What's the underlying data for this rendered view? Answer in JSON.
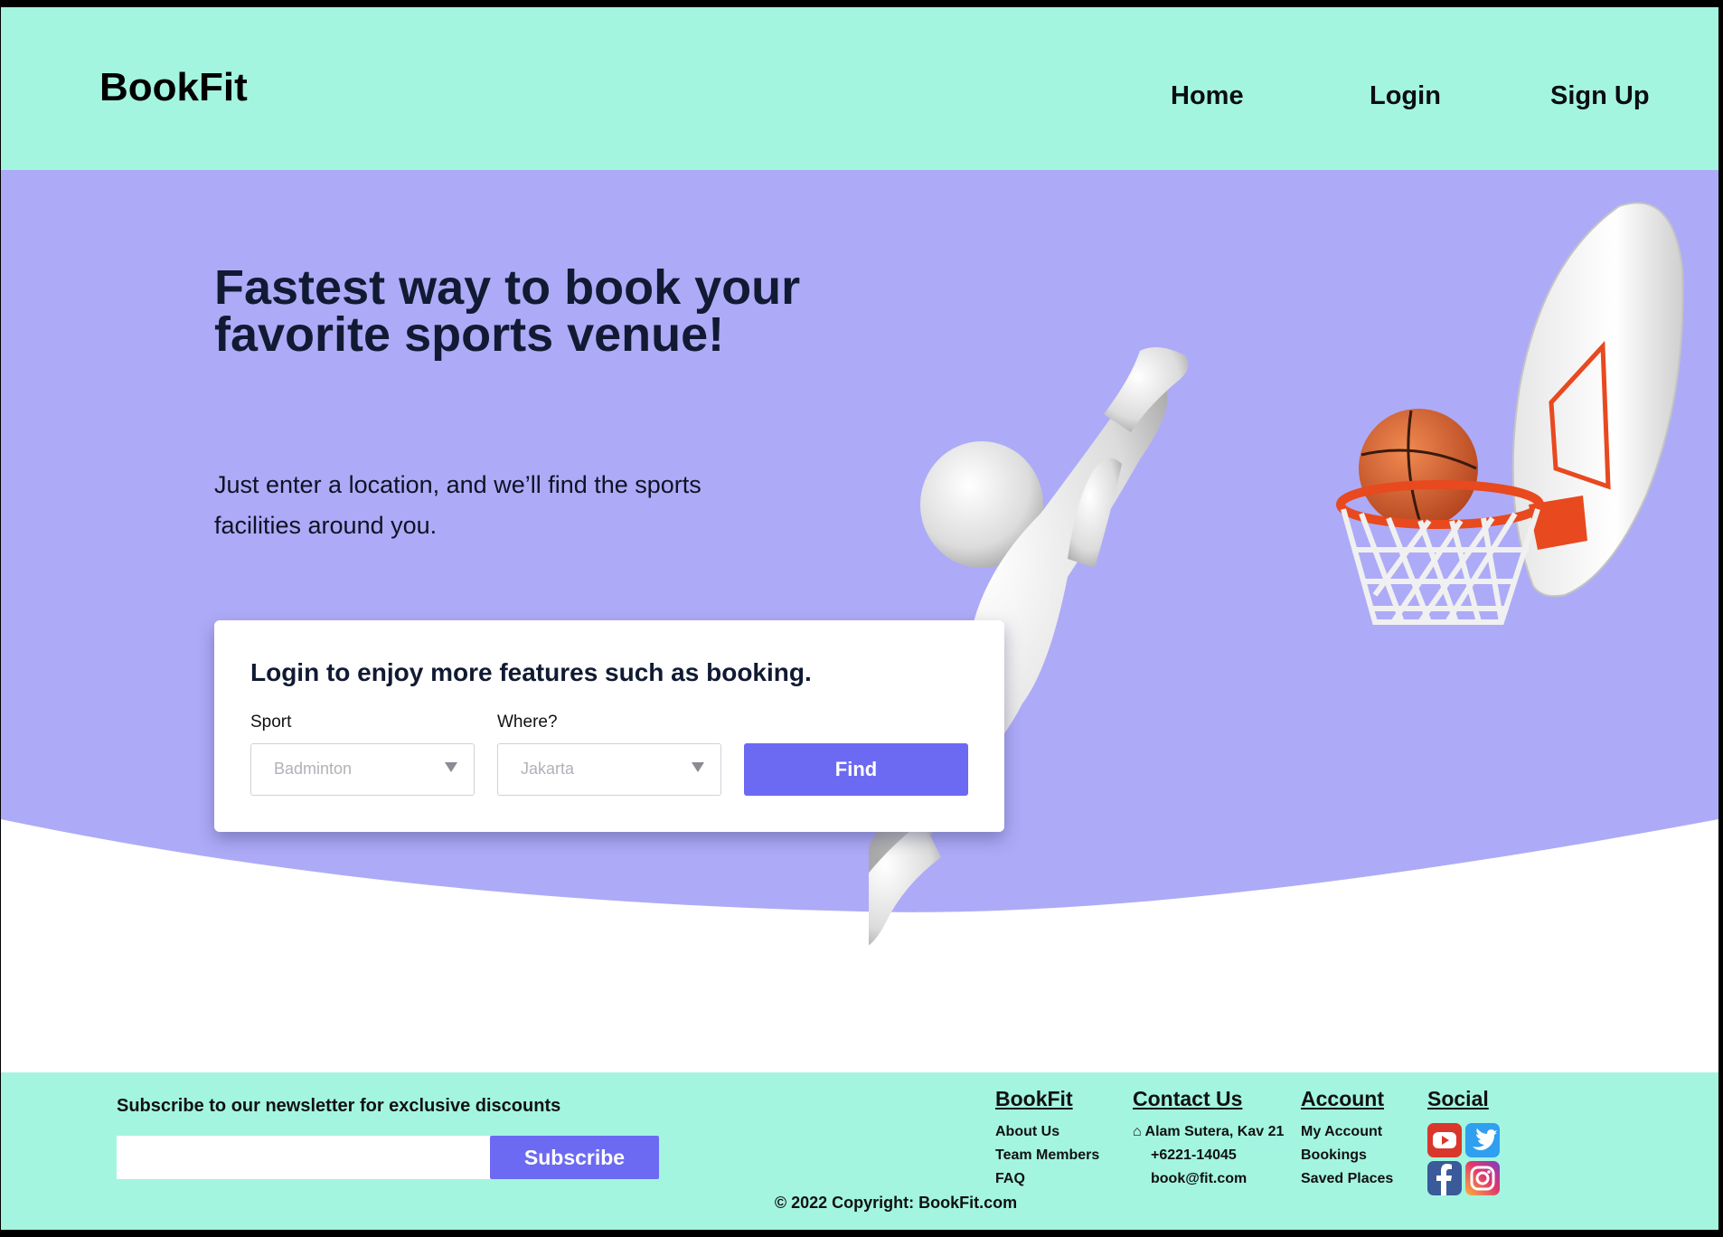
{
  "header": {
    "logo": "BookFit",
    "nav": {
      "home": "Home",
      "login": "Login",
      "signup": "Sign Up"
    }
  },
  "hero": {
    "title": "Fastest way to book your favorite sports venue!",
    "subtitle": "Just enter a location, and we’ll find the sports facilities around you."
  },
  "search": {
    "card_title": "Login to enjoy more features such as booking.",
    "sport_label": "Sport",
    "sport_value": "Badminton",
    "where_label": "Where?",
    "where_value": "Jakarta",
    "find_label": "Find"
  },
  "footer": {
    "newsletter_title": "Subscribe to our newsletter for exclusive discounts",
    "newsletter_placeholder": "",
    "subscribe_label": "Subscribe",
    "columns": {
      "bookfit": {
        "heading": "BookFit",
        "items": [
          "About Us",
          "Team Members",
          "FAQ"
        ]
      },
      "contact": {
        "heading": "Contact Us",
        "address": "⌂ Alam Sutera, Kav 21",
        "phone": "+6221-14045",
        "email": "book@fit.com"
      },
      "account": {
        "heading": "Account",
        "items": [
          "My Account",
          "Bookings",
          "Saved Places"
        ]
      },
      "social": {
        "heading": "Social",
        "icons": [
          "youtube-icon",
          "twitter-icon",
          "facebook-icon",
          "instagram-icon"
        ]
      }
    },
    "copyright": "© 2022 Copyright: BookFit.com"
  },
  "colors": {
    "mint": "#a3f5df",
    "lavender": "#adabf7",
    "accent": "#6c6af2",
    "hoop_orange": "#e8491f"
  }
}
